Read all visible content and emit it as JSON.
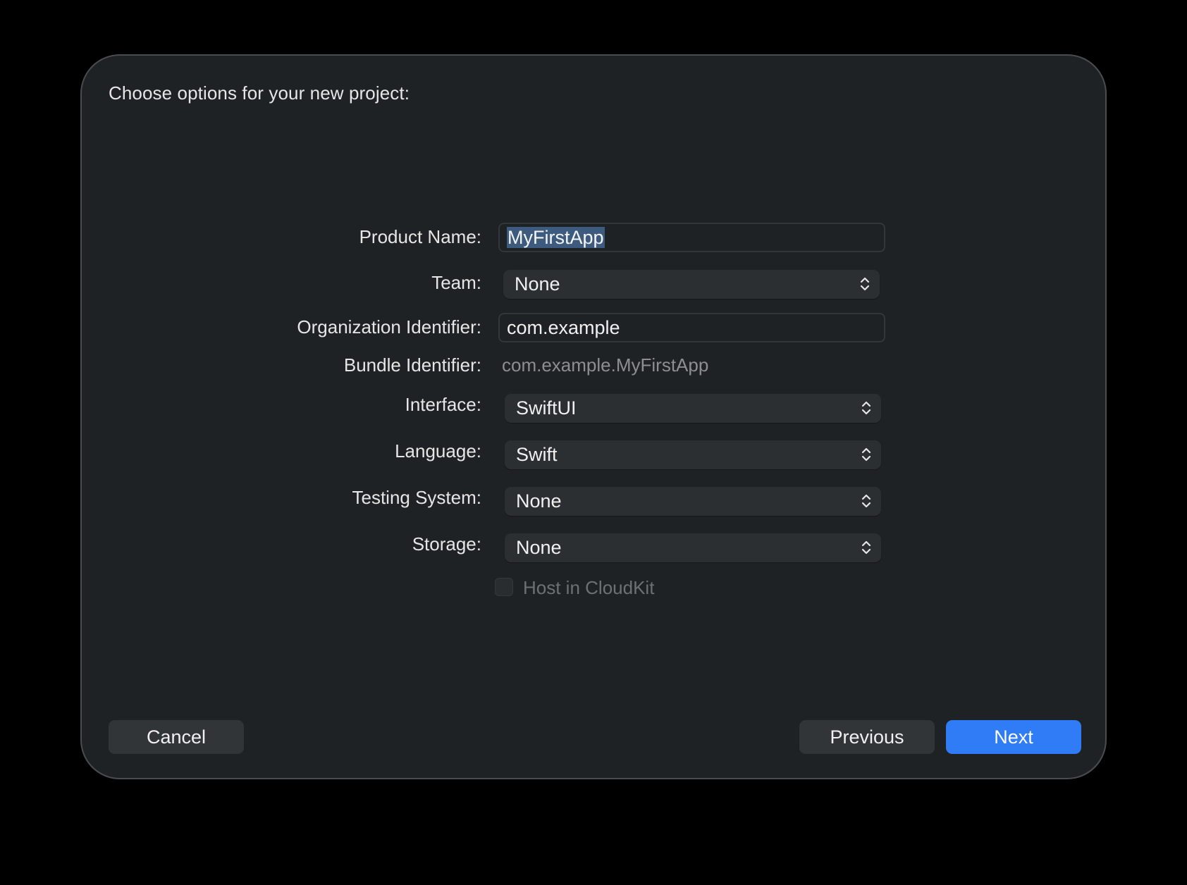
{
  "dialog": {
    "title": "Choose options for your new project:"
  },
  "form": {
    "product_name": {
      "label": "Product Name:",
      "value": "MyFirstApp"
    },
    "team": {
      "label": "Team:",
      "value": "None"
    },
    "organization_identifier": {
      "label": "Organization Identifier:",
      "value": "com.example"
    },
    "bundle_identifier": {
      "label": "Bundle Identifier:",
      "value": "com.example.MyFirstApp"
    },
    "interface": {
      "label": "Interface:",
      "value": "SwiftUI"
    },
    "language": {
      "label": "Language:",
      "value": "Swift"
    },
    "testing_system": {
      "label": "Testing System:",
      "value": "None"
    },
    "storage": {
      "label": "Storage:",
      "value": "None"
    },
    "host_in_cloudkit": {
      "label": "Host in CloudKit",
      "checked": false,
      "enabled": false
    }
  },
  "buttons": {
    "cancel": "Cancel",
    "previous": "Previous",
    "next": "Next"
  },
  "colors": {
    "accent": "#2f7cf6",
    "selection": "#3d5a7f",
    "dialog_bg": "#1f2224"
  },
  "icons": {
    "popup_indicator": "chevron-up-down-icon"
  }
}
